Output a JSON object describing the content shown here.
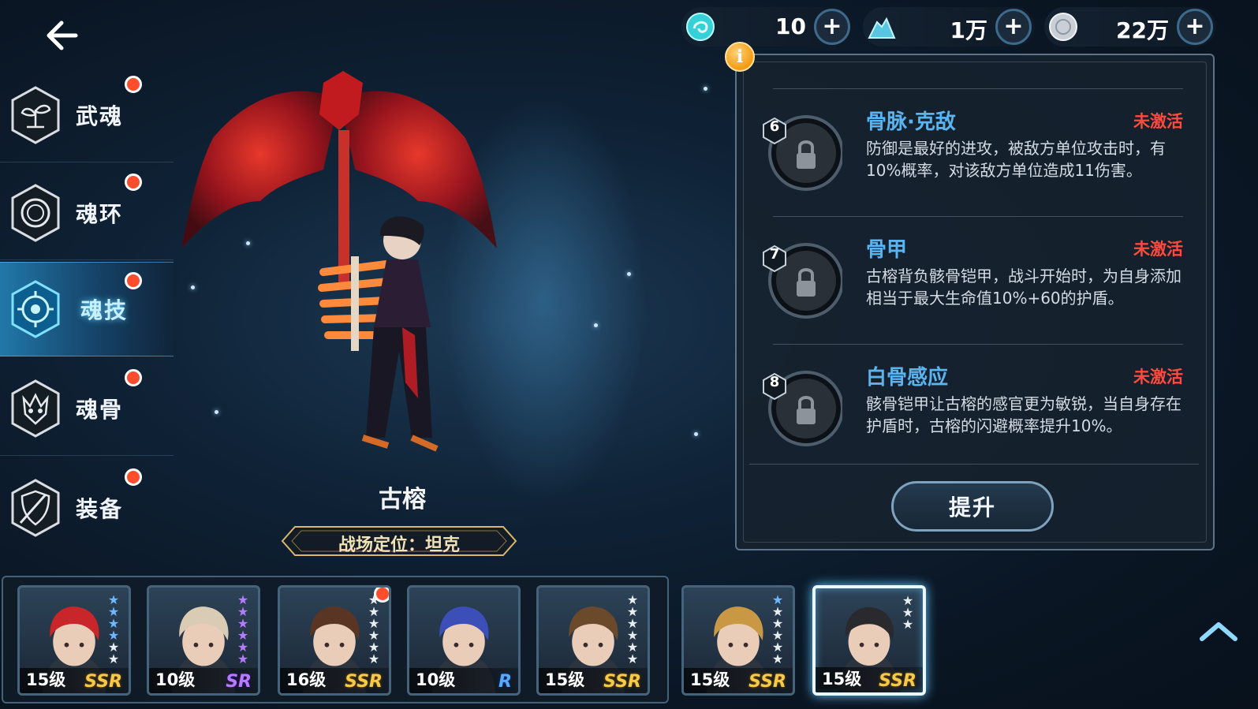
{
  "nav": {
    "items": [
      {
        "label": "武魂",
        "icon": "sprout-emblem-icon",
        "badge": true,
        "active": false
      },
      {
        "label": "魂环",
        "icon": "ring-emblem-icon",
        "badge": true,
        "active": false
      },
      {
        "label": "魂技",
        "icon": "skill-emblem-icon",
        "badge": true,
        "active": true
      },
      {
        "label": "魂骨",
        "icon": "skull-emblem-icon",
        "badge": true,
        "active": false
      },
      {
        "label": "装备",
        "icon": "shield-emblem-icon",
        "badge": true,
        "active": false
      }
    ]
  },
  "currencies": [
    {
      "icon": "soul-crystal-icon",
      "value": "10"
    },
    {
      "icon": "diamond-pile-icon",
      "value": "1万"
    },
    {
      "icon": "silver-coin-icon",
      "value": "22万"
    }
  ],
  "hero": {
    "name": "古榕",
    "role": "战场定位：坦克"
  },
  "skills": [
    {
      "level": "6",
      "name": "骨脉·克敌",
      "status": "未激活",
      "desc": "防御是最好的进攻，被敌方单位攻击时，有10%概率，对该敌方单位造成11伤害。"
    },
    {
      "level": "7",
      "name": "骨甲",
      "status": "未激活",
      "desc": "古榕背负骸骨铠甲，战斗开始时，为自身添加相当于最大生命值10%+60的护盾。"
    },
    {
      "level": "8",
      "name": "白骨感应",
      "status": "未激活",
      "desc": "骸骨铠甲让古榕的感官更为敏锐，当自身存在护盾时，古榕的闪避概率提升10%。"
    }
  ],
  "info_label": "i",
  "upgrade_label": "提升",
  "roster": [
    {
      "level": "15级",
      "rank": "SSR",
      "stars": 6,
      "filled": 4,
      "star_color": "#6fb8ff",
      "badge": false,
      "selected": false,
      "hair": "#c8262a"
    },
    {
      "level": "10级",
      "rank": "SR",
      "stars": 6,
      "filled": 6,
      "star_color": "#b57cff",
      "badge": false,
      "selected": false,
      "hair": "#d9cbb4"
    },
    {
      "level": "16级",
      "rank": "SSR",
      "stars": 6,
      "filled": 0,
      "star_color": "#ffffff",
      "badge": true,
      "selected": false,
      "hair": "#5a3524"
    },
    {
      "level": "10级",
      "rank": "R",
      "stars": 0,
      "filled": 0,
      "star_color": "#ffffff",
      "badge": false,
      "selected": false,
      "hair": "#3c4fb8"
    },
    {
      "level": "15级",
      "rank": "SSR",
      "stars": 6,
      "filled": 0,
      "star_color": "#ffffff",
      "badge": false,
      "selected": false,
      "hair": "#6b4a2c"
    },
    {
      "level": "15级",
      "rank": "SSR",
      "stars": 6,
      "filled": 1,
      "star_color": "#6fb8ff",
      "badge": false,
      "selected": false,
      "hair": "#c99845"
    },
    {
      "level": "15级",
      "rank": "SSR",
      "stars": 3,
      "filled": 0,
      "star_color": "#ffffff",
      "badge": false,
      "selected": true,
      "hair": "#2a2a2e"
    }
  ],
  "colors": {
    "accent_blue": "#5ab4f0",
    "inactive_red": "#ff4a3d",
    "badge_red": "#ff4d2e",
    "ssr_gold": "#f7c948"
  }
}
